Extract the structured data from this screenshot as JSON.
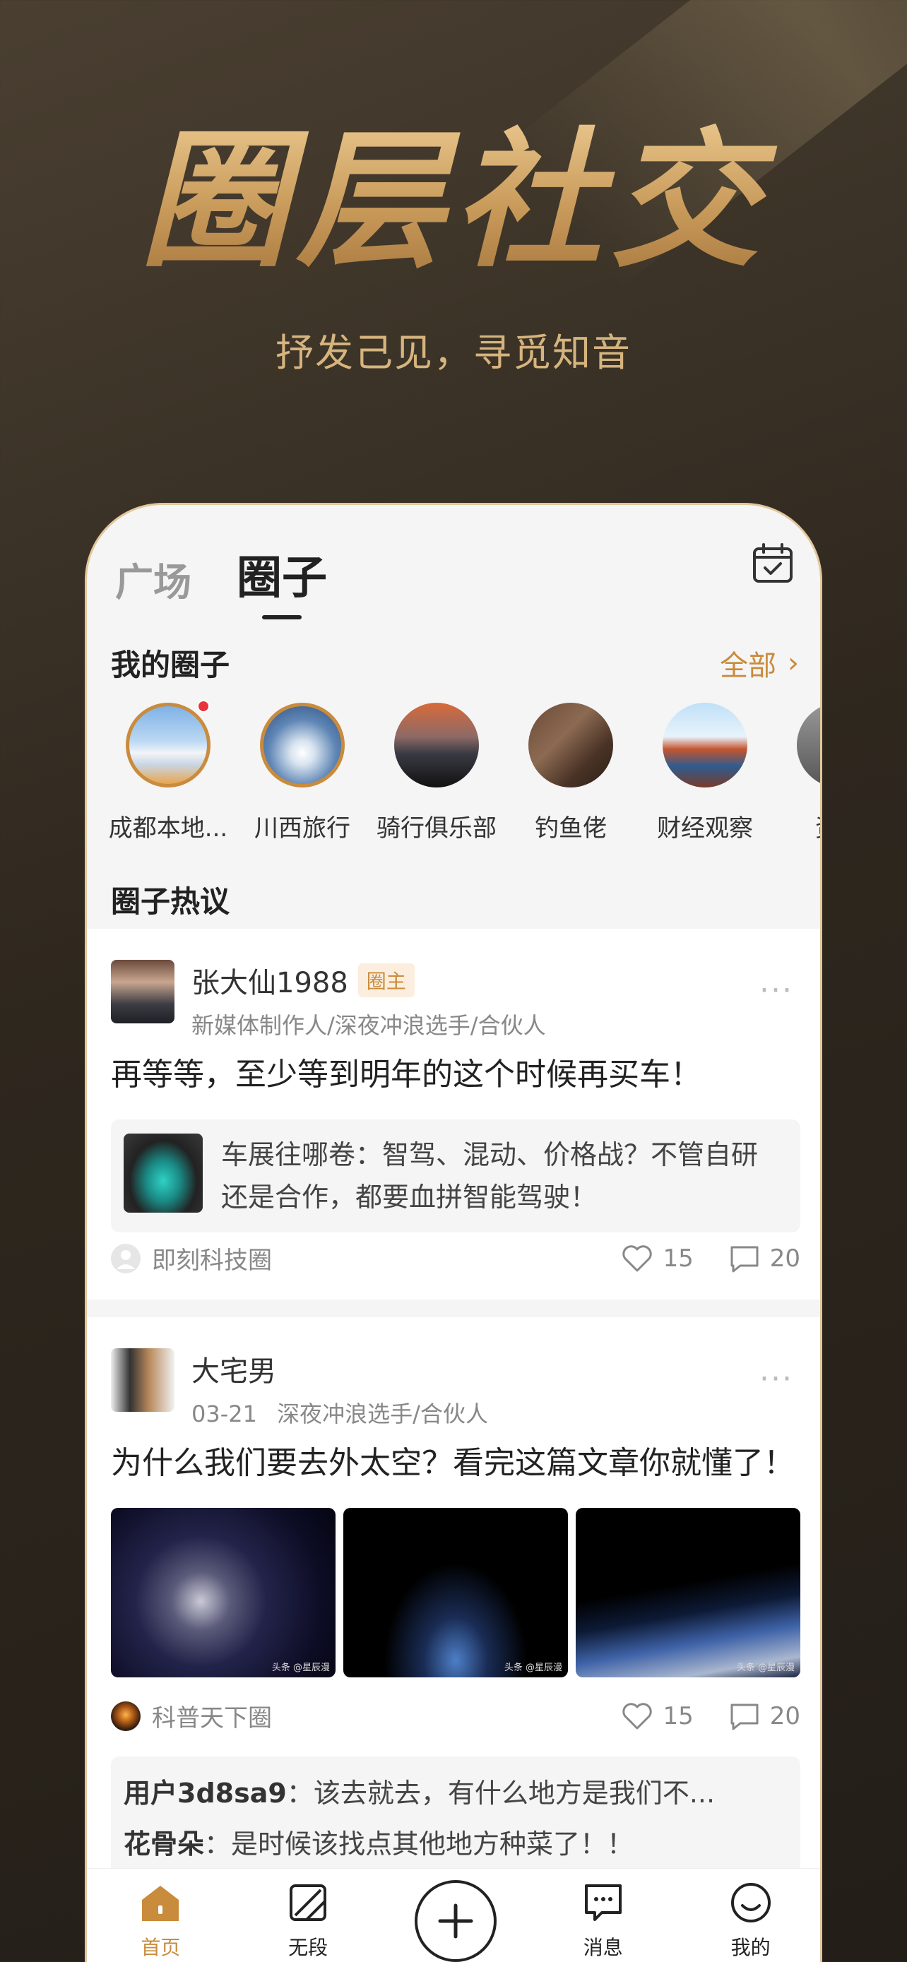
{
  "hero": {
    "title": "圈层社交",
    "subtitle": "抒发己见，寻觅知音"
  },
  "tabs": {
    "plaza": "广场",
    "circle": "圈子"
  },
  "my_circles": {
    "title": "我的圈子",
    "all_label": "全部",
    "items": [
      {
        "name": "成都本地..."
      },
      {
        "name": "川西旅行"
      },
      {
        "name": "骑行俱乐部"
      },
      {
        "name": "钓鱼佬"
      },
      {
        "name": "财经观察"
      },
      {
        "name": "资讯"
      }
    ]
  },
  "hot": {
    "title": "圈子热议"
  },
  "posts": [
    {
      "author": "张大仙1988",
      "badge": "圈主",
      "meta": "新媒体制作人/深夜冲浪选手/合伙人",
      "text": "再等等，至少等到明年的这个时候再买车！",
      "quote_line1": "车展往哪卷：智驾、混动、价格战？不管自研",
      "quote_line2": "还是合作，都要血拼智能驾驶！",
      "source": "即刻科技圈",
      "likes": "15",
      "comments": "20"
    },
    {
      "author": "大宅男",
      "date": "03-21",
      "meta": "深夜冲浪选手/合伙人",
      "text": "为什么我们要去外太空？看完这篇文章你就懂了！",
      "source": "科普天下圈",
      "likes": "15",
      "comments": "20",
      "watermark": "头条 @星辰漫",
      "comment_list": [
        {
          "user": "用户3d8sa9",
          "text": "该去就去，有什么地方是我们不..."
        },
        {
          "user": "花骨朵",
          "text": "是时候该找点其他地方种菜了！！"
        }
      ]
    }
  ],
  "tabbar": {
    "home": "首页",
    "wuduan": "无段",
    "messages": "消息",
    "mine": "我的"
  },
  "colors": {
    "accent": "#c98b3c",
    "hero_gold": "#d2a86a",
    "badge_dot": "#e8343a"
  }
}
